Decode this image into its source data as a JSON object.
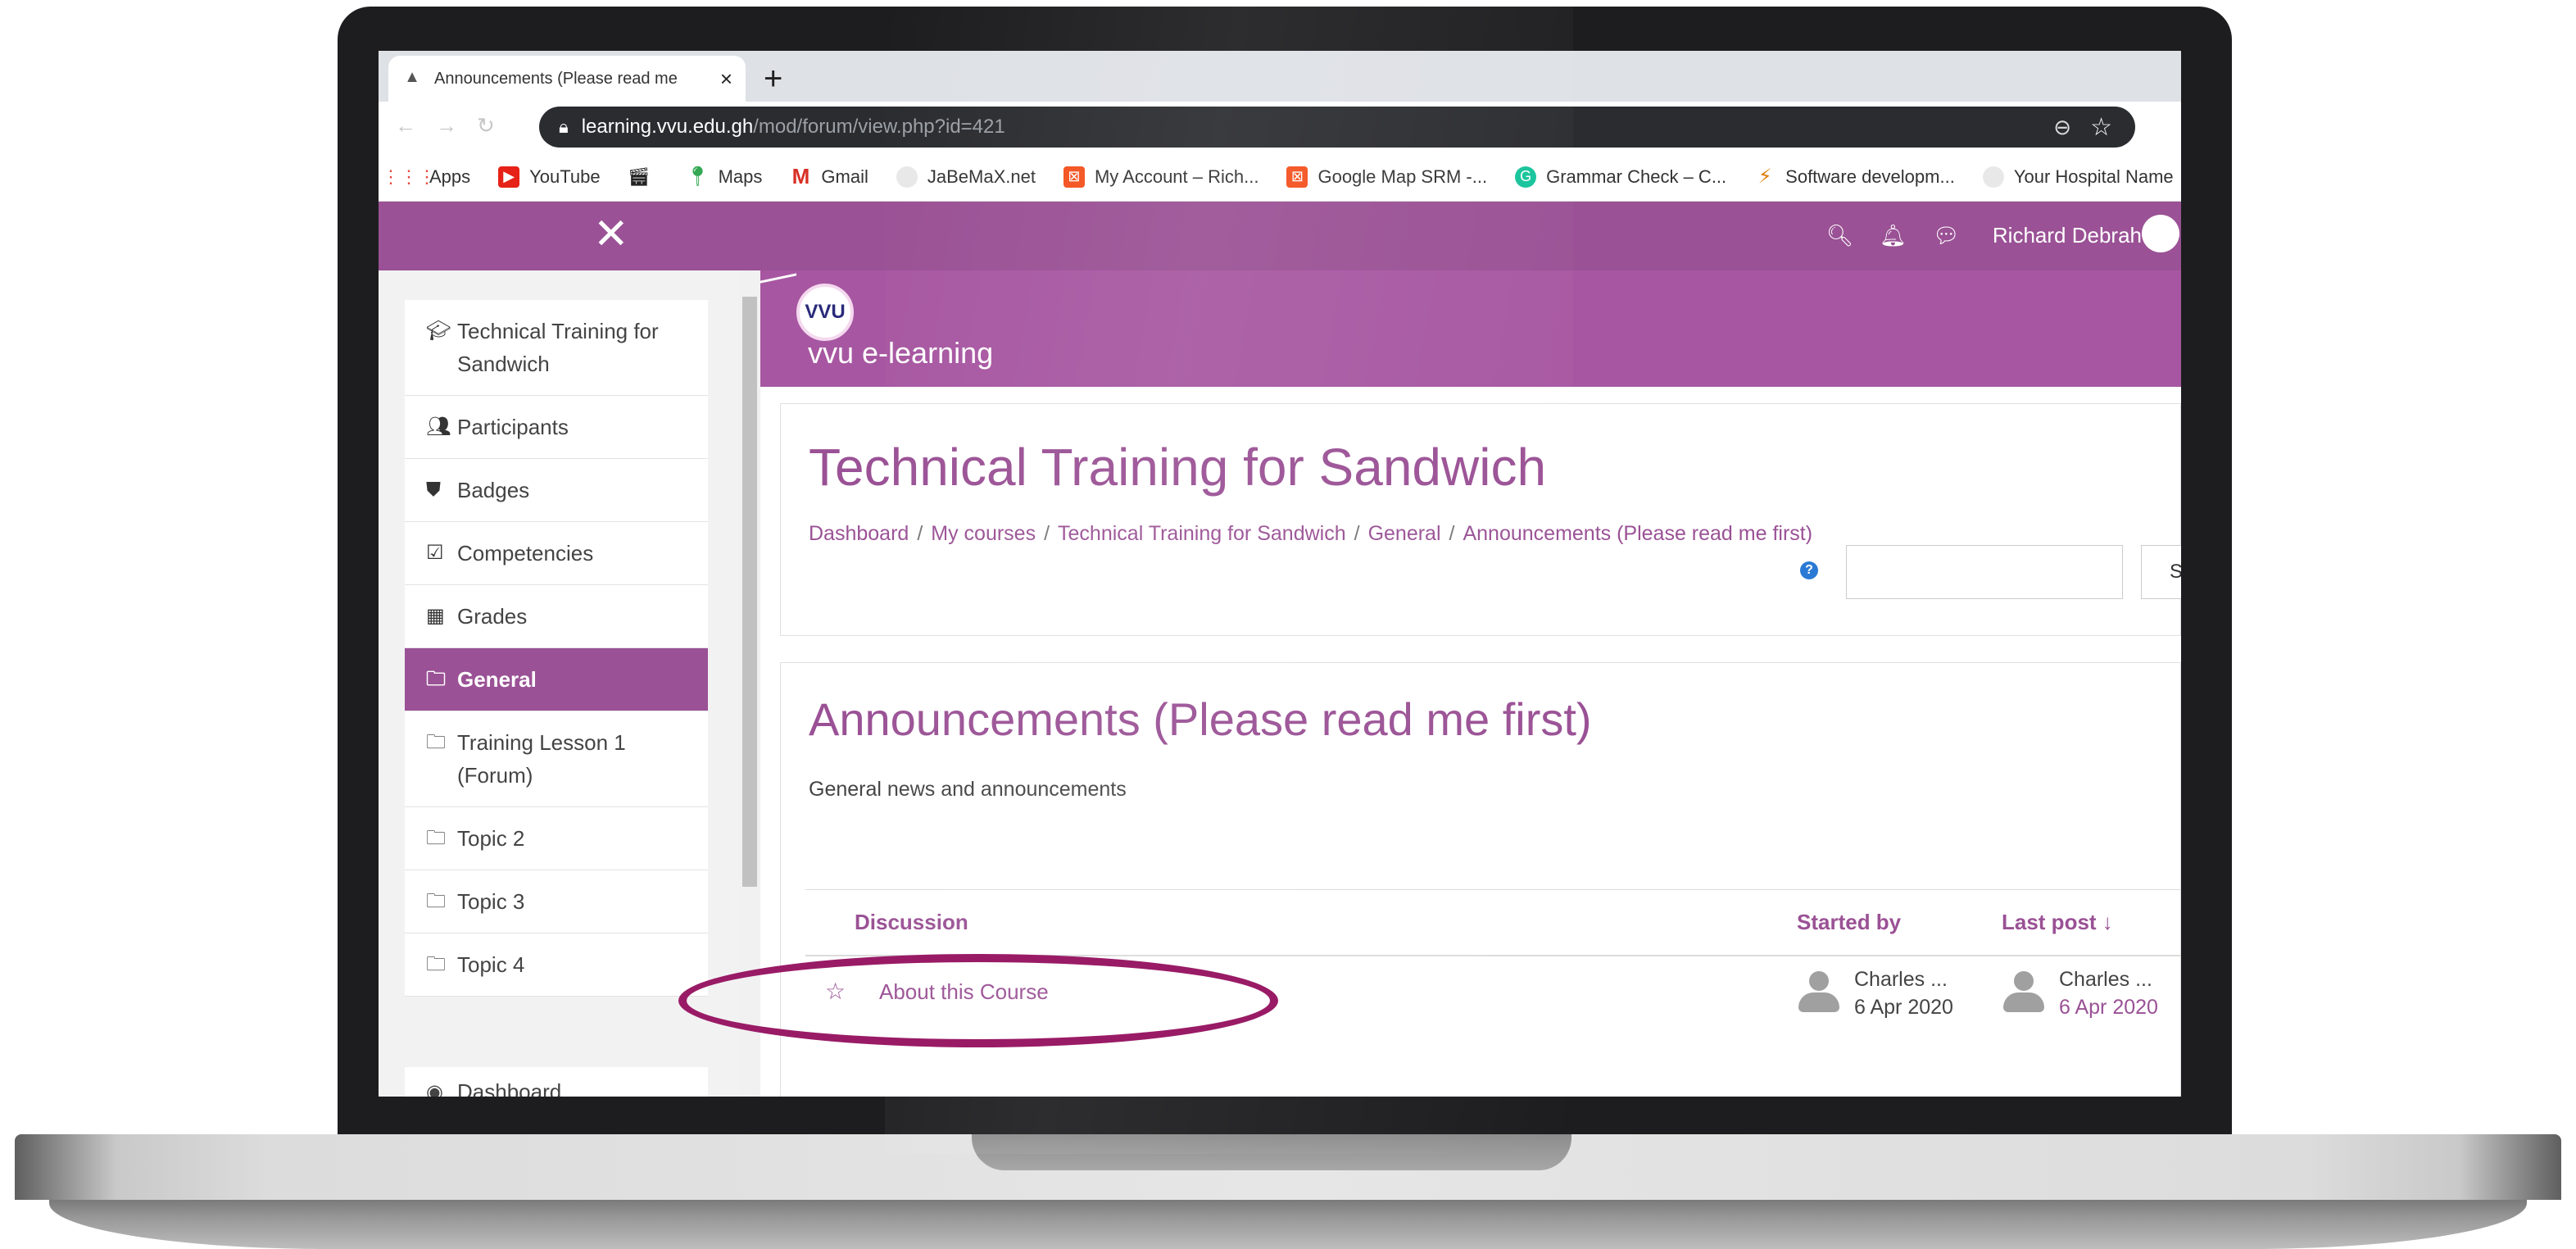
{
  "browser": {
    "tab_title": "Announcements (Please read me",
    "tab_close": "×",
    "new_tab": "+",
    "url_host": "learning.vvu.edu.gh",
    "url_path": "/mod/forum/view.php?id=421",
    "bookmarks": [
      {
        "label": "Apps",
        "icon": "apps-grid-icon"
      },
      {
        "label": "YouTube",
        "icon": "youtube-icon"
      },
      {
        "label": "",
        "icon": "clapper-icon"
      },
      {
        "label": "Maps",
        "icon": "maps-icon"
      },
      {
        "label": "Gmail",
        "icon": "gmail-icon"
      },
      {
        "label": "JaBeMaX.net",
        "icon": "globe-icon"
      },
      {
        "label": "My Account – Rich...",
        "icon": "bookmark-icon"
      },
      {
        "label": "Google Map SRM -...",
        "icon": "bookmark-icon"
      },
      {
        "label": "Grammar Check – C...",
        "icon": "grammarly-icon"
      },
      {
        "label": "Software developm...",
        "icon": "lightning-icon"
      },
      {
        "label": "Your Hospital Name",
        "icon": "globe-icon"
      }
    ]
  },
  "navbar": {
    "close_glyph": "✕",
    "user_name": "Richard Debrah",
    "accent": "#9a5195"
  },
  "drawer": {
    "items": [
      {
        "icon": "graduation-cap-icon",
        "label": "Technical Training for Sandwich",
        "active": false
      },
      {
        "icon": "users-icon",
        "label": "Participants",
        "active": false
      },
      {
        "icon": "shield-icon",
        "label": "Badges",
        "active": false
      },
      {
        "icon": "checkbox-icon",
        "label": "Competencies",
        "active": false
      },
      {
        "icon": "table-icon",
        "label": "Grades",
        "active": false
      },
      {
        "icon": "folder-icon",
        "label": "General",
        "active": true
      },
      {
        "icon": "folder-icon",
        "label": "Training Lesson 1 (Forum)",
        "active": false
      },
      {
        "icon": "folder-icon",
        "label": "Topic 2",
        "active": false
      },
      {
        "icon": "folder-icon",
        "label": "Topic 3",
        "active": false
      },
      {
        "icon": "folder-icon",
        "label": "Topic 4",
        "active": false
      }
    ],
    "dashboard_label": "Dashboard"
  },
  "banner": {
    "logo_text": "vvu e-learning",
    "logo_badge": "VVU"
  },
  "course": {
    "title": "Technical Training for Sandwich",
    "breadcrumb": [
      "Dashboard",
      "My courses",
      "Technical Training for Sandwich",
      "General",
      "Announcements (Please read me first)"
    ],
    "search_button": "SE",
    "help_glyph": "?"
  },
  "forum": {
    "title": "Announcements (Please read me first)",
    "description": "General news and announcements",
    "columns": {
      "discussion": "Discussion",
      "started_by": "Started by",
      "last_post": "Last post ↓"
    },
    "rows": [
      {
        "discussion": "About this Course",
        "started_by_name": "Charles ...",
        "started_by_date": "6 Apr 2020",
        "last_post_name": "Charles ...",
        "last_post_date": "6 Apr 2020"
      }
    ]
  }
}
